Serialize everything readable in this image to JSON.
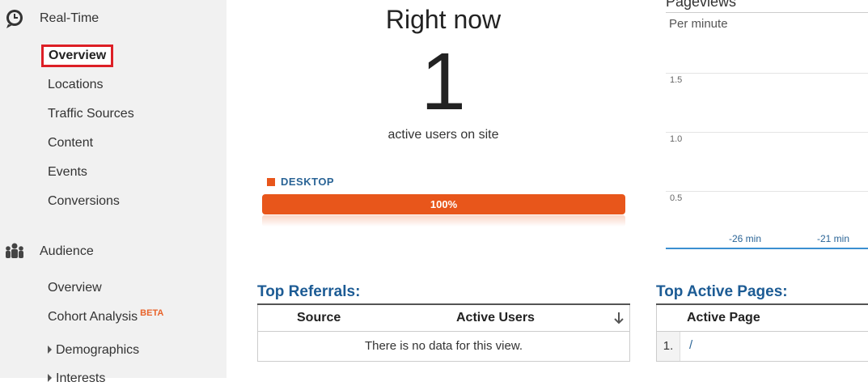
{
  "sidebar": {
    "realtime": {
      "label": "Real-Time",
      "items": [
        "Overview",
        "Locations",
        "Traffic Sources",
        "Content",
        "Events",
        "Conversions"
      ]
    },
    "audience": {
      "label": "Audience",
      "items": [
        "Overview",
        "Cohort Analysis",
        "Demographics",
        "Interests"
      ],
      "beta_badge": "BETA"
    }
  },
  "right_now": {
    "title": "Right now",
    "count": "1",
    "label": "active users on site"
  },
  "device": {
    "legend": "DESKTOP",
    "percent": "100%",
    "share": 1.0,
    "color": "#e8561b"
  },
  "pageviews": {
    "title": "Pageviews",
    "subtitle": "Per minute",
    "y_ticks": [
      "1.5",
      "1.0",
      "0.5"
    ],
    "x_ticks": [
      "-26 min",
      "-21 min"
    ]
  },
  "referrals": {
    "title": "Top Referrals:",
    "columns": [
      "Source",
      "Active Users"
    ],
    "empty_text": "There is no data for this view."
  },
  "active_pages": {
    "title": "Top Active Pages:",
    "columns": [
      "Active Page"
    ],
    "rows": [
      {
        "num": "1.",
        "page": "/"
      }
    ]
  },
  "colors": {
    "accent": "#e8561b",
    "link": "#2a6496",
    "highlight_border": "#dd1f26"
  }
}
